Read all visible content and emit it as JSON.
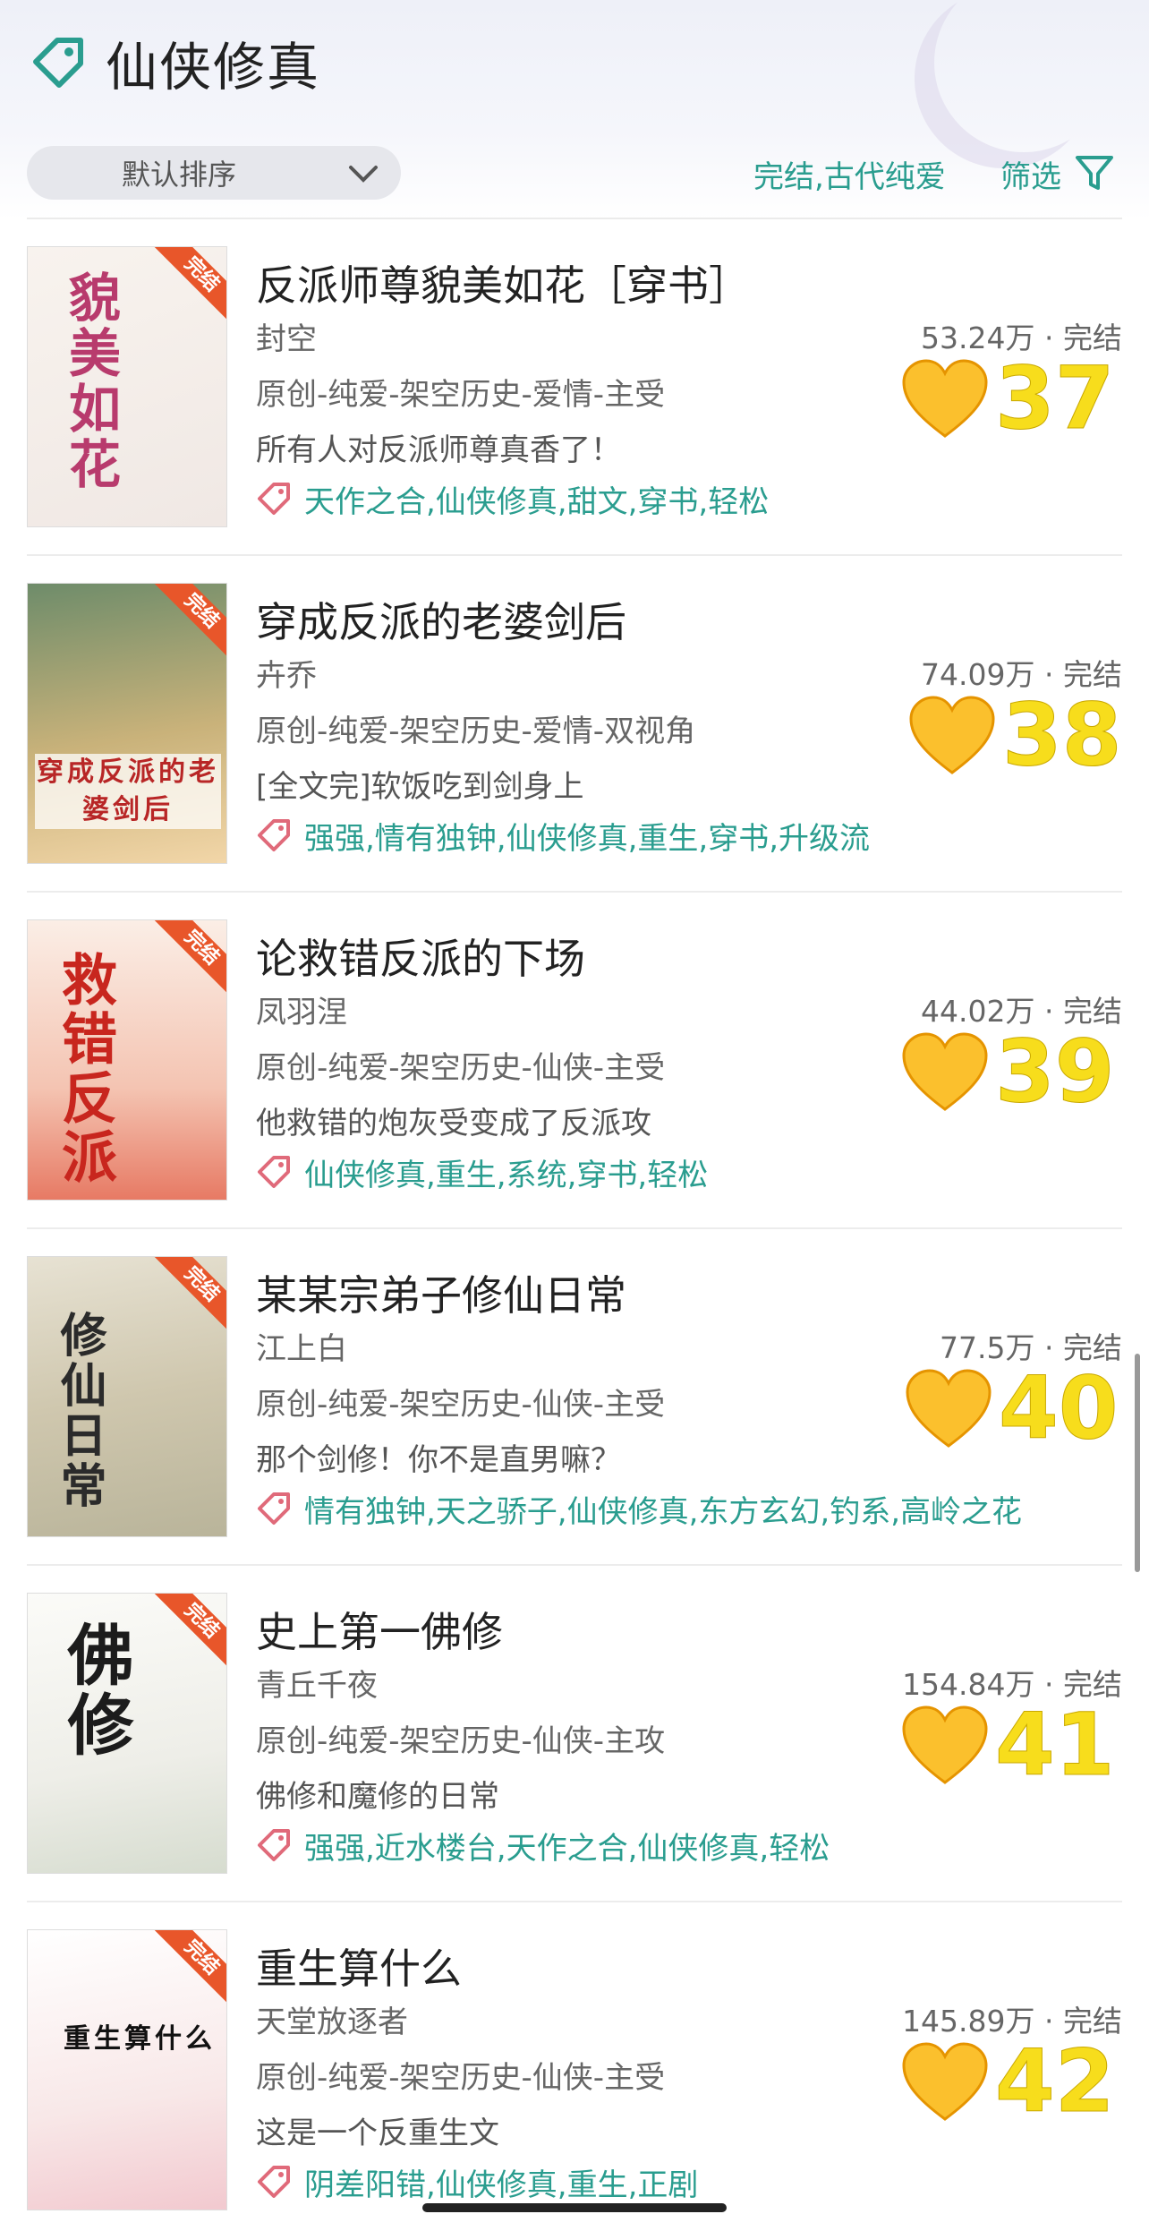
{
  "header": {
    "title": "仙侠修真",
    "sort_label": "默认排序",
    "active_filters": "完结,古代纯爱",
    "filter_label": "筛选"
  },
  "books": [
    {
      "title": "反派师尊貌美如花［穿书］",
      "author": "封空",
      "stat": "53.24万 · 完结",
      "category": "原创-纯爱-架空历史-爱情-主受",
      "desc": "所有人对反派师尊真香了！",
      "tags": "天作之合,仙侠修真,甜文,穿书,轻松",
      "rank": "37",
      "cover_text": "貌美如花",
      "ribbon": "完结"
    },
    {
      "title": "穿成反派的老婆剑后",
      "author": "卉乔",
      "stat": "74.09万 · 完结",
      "category": "原创-纯爱-架空历史-爱情-双视角",
      "desc": "[全文完]软饭吃到剑身上",
      "tags": "强强,情有独钟,仙侠修真,重生,穿书,升级流",
      "rank": "38",
      "cover_text": "穿成反派的老婆剑后",
      "ribbon": "完结"
    },
    {
      "title": "论救错反派的下场",
      "author": "凤羽涅",
      "stat": "44.02万 · 完结",
      "category": "原创-纯爱-架空历史-仙侠-主受",
      "desc": "他救错的炮灰受变成了反派攻",
      "tags": "仙侠修真,重生,系统,穿书,轻松",
      "rank": "39",
      "cover_text": "救错反派",
      "ribbon": "完结"
    },
    {
      "title": "某某宗弟子修仙日常",
      "author": "江上白",
      "stat": "77.5万 · 完结",
      "category": "原创-纯爱-架空历史-仙侠-主受",
      "desc": "那个剑修！你不是直男嘛？",
      "tags": "情有独钟,天之骄子,仙侠修真,东方玄幻,钓系,高岭之花",
      "rank": "40",
      "cover_text": "修仙日常",
      "ribbon": "完结"
    },
    {
      "title": "史上第一佛修",
      "author": "青丘千夜",
      "stat": "154.84万 · 完结",
      "category": "原创-纯爱-架空历史-仙侠-主攻",
      "desc": "佛修和魔修的日常",
      "tags": "强强,近水楼台,天作之合,仙侠修真,轻松",
      "rank": "41",
      "cover_text": "佛修",
      "ribbon": "完结"
    },
    {
      "title": "重生算什么",
      "author": "天堂放逐者",
      "stat": "145.89万 · 完结",
      "category": "原创-纯爱-架空历史-仙侠-主受",
      "desc": "这是一个反重生文",
      "tags": "阴差阳错,仙侠修真,重生,正剧",
      "rank": "42",
      "cover_text": "重生算什么",
      "ribbon": "完结"
    }
  ]
}
